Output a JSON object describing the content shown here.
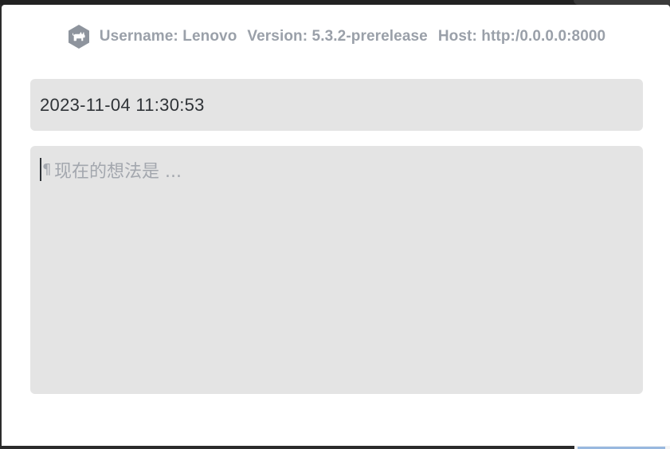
{
  "header": {
    "logo_icon": "hexagon-cat-logo-icon",
    "username": "Username: Lenovo",
    "version": "Version: 5.3.2-prerelease",
    "host": "Host: http:/0.0.0.0:8000"
  },
  "date_field": {
    "value": "2023-11-04 11:30:53"
  },
  "memo": {
    "placeholder": "现在的想法是 ...",
    "value": "",
    "pilcrow": "¶"
  },
  "colors": {
    "box_bg": "#e4e4e4",
    "meta_text": "#9aa0a9",
    "placeholder": "#a3a7ae",
    "body_text": "#2f3337"
  }
}
